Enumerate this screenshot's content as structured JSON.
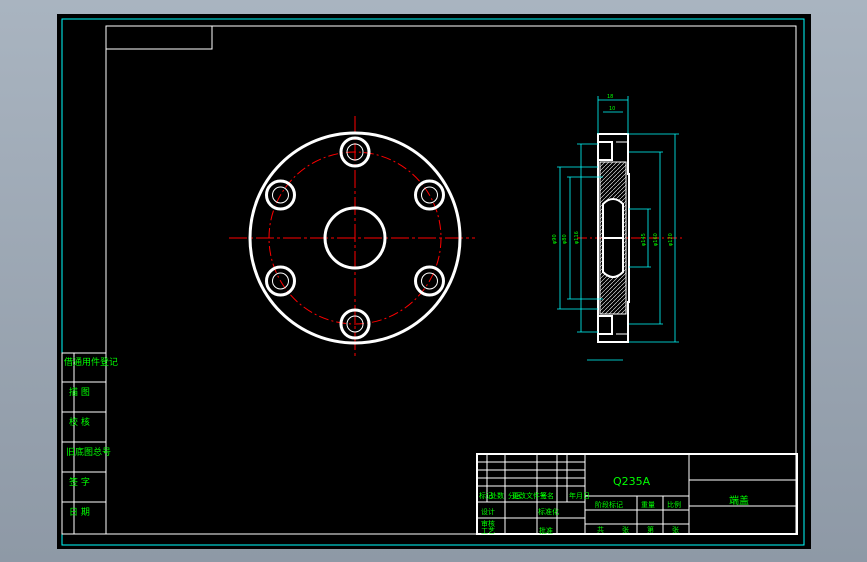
{
  "side_block": {
    "rows": [
      "借通用件登记",
      "描 图",
      "校 核",
      "旧底图总号",
      "签 字",
      "日 期"
    ]
  },
  "title_block": {
    "material": "Q235A",
    "part_name": "端盖",
    "labels": {
      "mark": "标记",
      "count": "处数",
      "zone": "分区",
      "change_doc": "更改文件号",
      "signature": "签名",
      "date": "年月日",
      "design": "设计",
      "standardize": "标准化",
      "stage_mark": "阶段标记",
      "weight": "重量",
      "scale": "比例",
      "review": "审核",
      "process": "工艺",
      "approve": "批准",
      "total": "共",
      "sheet": "张",
      "page": "第",
      "page_sheet": "张"
    }
  },
  "section_dims": [
    "18",
    "10",
    "φ90",
    "φ116",
    "φ80",
    "φ120",
    "φ160",
    "φ145"
  ],
  "colors": {
    "background": "#000000",
    "outline": "#ffffff",
    "frame": "#00ffff",
    "centerline": "#ff0000",
    "text": "#00ff00"
  }
}
